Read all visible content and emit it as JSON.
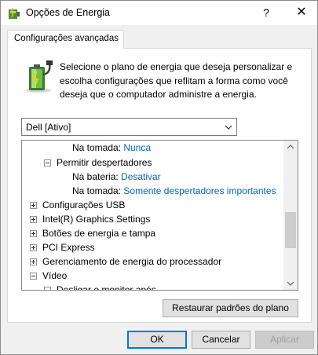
{
  "window": {
    "title": "Opções de Energia",
    "help_glyph": "?",
    "close_glyph": "✕"
  },
  "tab": {
    "label": "Configurações avançadas"
  },
  "description": "Selecione o plano de energia que deseja personalizar e escolha configurações que reflitam a forma como você deseja que o computador administre a energia.",
  "plan_select": {
    "value": "Dell [Ativo]"
  },
  "tree": {
    "rows": [
      {
        "label": "Na tomada:",
        "value": "Nunca"
      },
      {
        "label": "Permitir despertadores",
        "expander": "minus"
      },
      {
        "label": "Na bateria:",
        "value": "Desativar"
      },
      {
        "label": "Na tomada:",
        "value": "Somente despertadores importantes"
      },
      {
        "label": "Configurações USB",
        "expander": "plus"
      },
      {
        "label": "Intel(R) Graphics Settings",
        "expander": "plus"
      },
      {
        "label": "Botões de energia e tampa",
        "expander": "plus"
      },
      {
        "label": "PCI Express",
        "expander": "plus"
      },
      {
        "label": "Gerenciamento de energia do processador",
        "expander": "plus"
      },
      {
        "label": "Vídeo",
        "expander": "minus"
      },
      {
        "label": "Desligar o monitor após",
        "expander": "minus"
      }
    ]
  },
  "buttons": {
    "restore": "Restaurar padrões do plano",
    "ok": "OK",
    "cancel": "Cancelar",
    "apply": "Aplicar"
  },
  "colors": {
    "link": "#0066cc",
    "accent": "#0078d7"
  }
}
